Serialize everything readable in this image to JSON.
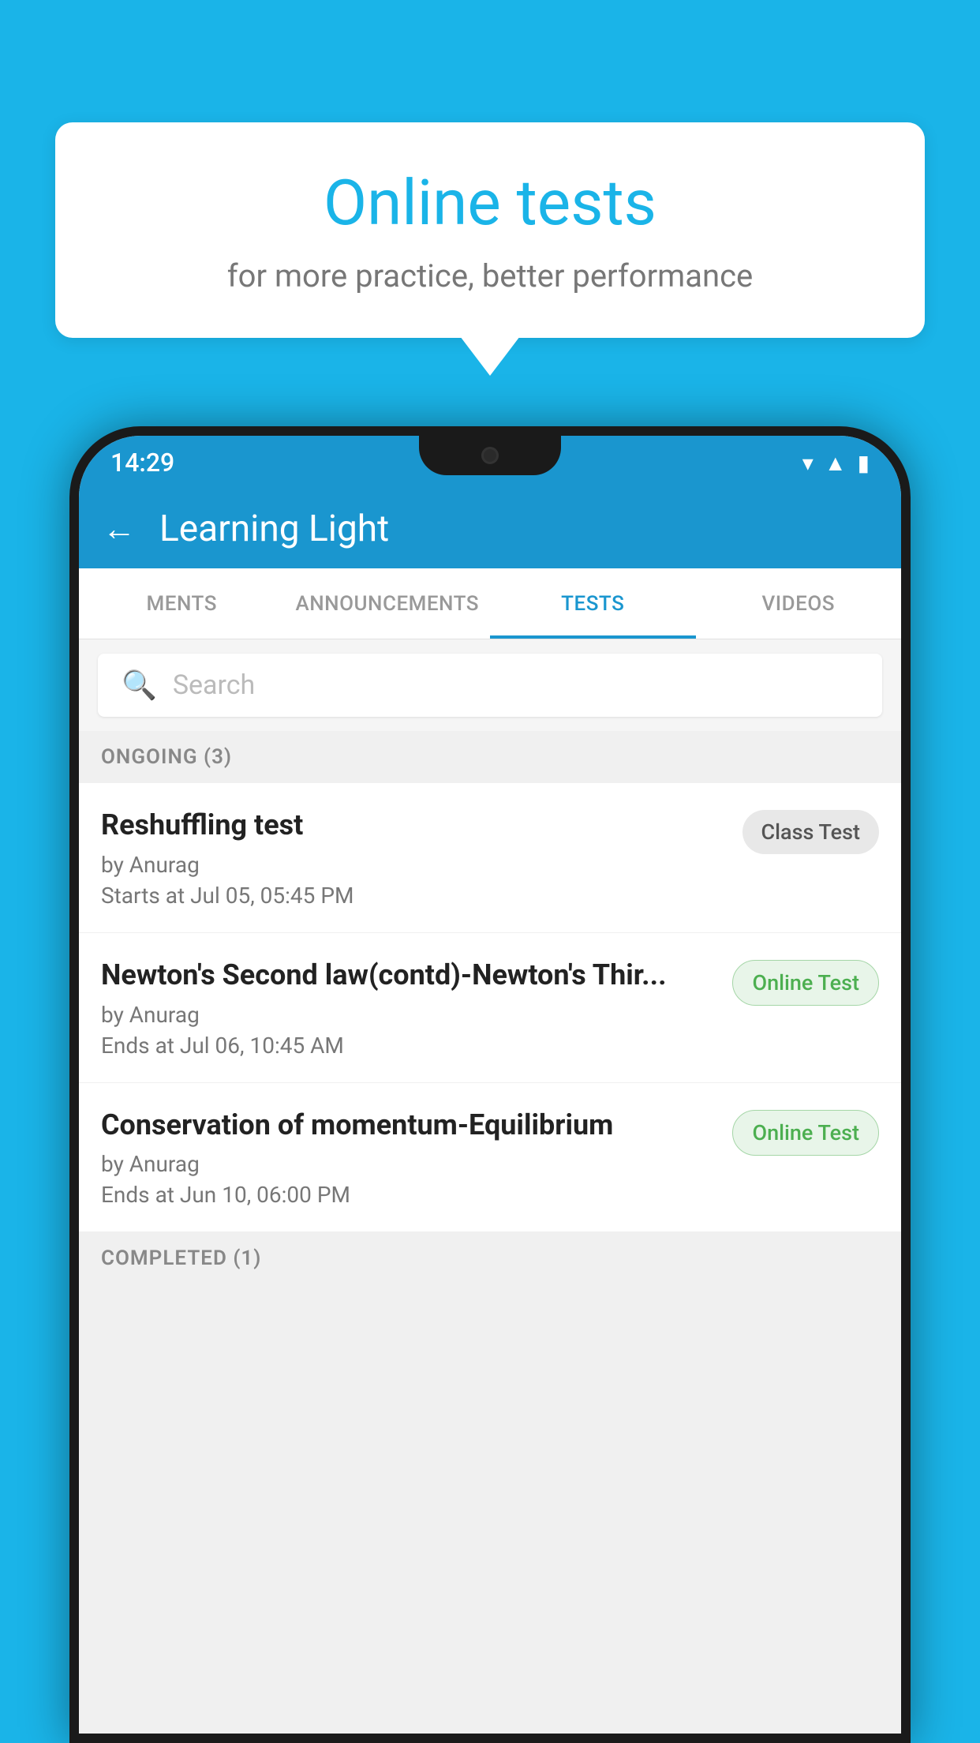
{
  "background_color": "#1ab4e8",
  "speech_bubble": {
    "title": "Online tests",
    "subtitle": "for more practice, better performance"
  },
  "status_bar": {
    "time": "14:29",
    "icons": [
      "wifi",
      "signal",
      "battery"
    ]
  },
  "app_bar": {
    "title": "Learning Light",
    "back_label": "←"
  },
  "tabs": [
    {
      "label": "MENTS",
      "active": false
    },
    {
      "label": "ANNOUNCEMENTS",
      "active": false
    },
    {
      "label": "TESTS",
      "active": true
    },
    {
      "label": "VIDEOS",
      "active": false
    }
  ],
  "search": {
    "placeholder": "Search"
  },
  "sections": [
    {
      "header": "ONGOING (3)",
      "tests": [
        {
          "name": "Reshuffling test",
          "author": "by Anurag",
          "time_label": "Starts at",
          "time_value": "Jul 05, 05:45 PM",
          "badge": "Class Test",
          "badge_type": "class"
        },
        {
          "name": "Newton's Second law(contd)-Newton's Thir...",
          "author": "by Anurag",
          "time_label": "Ends at",
          "time_value": "Jul 06, 10:45 AM",
          "badge": "Online Test",
          "badge_type": "online"
        },
        {
          "name": "Conservation of momentum-Equilibrium",
          "author": "by Anurag",
          "time_label": "Ends at",
          "time_value": "Jun 10, 06:00 PM",
          "badge": "Online Test",
          "badge_type": "online"
        }
      ]
    }
  ],
  "completed_section": {
    "header": "COMPLETED (1)"
  }
}
